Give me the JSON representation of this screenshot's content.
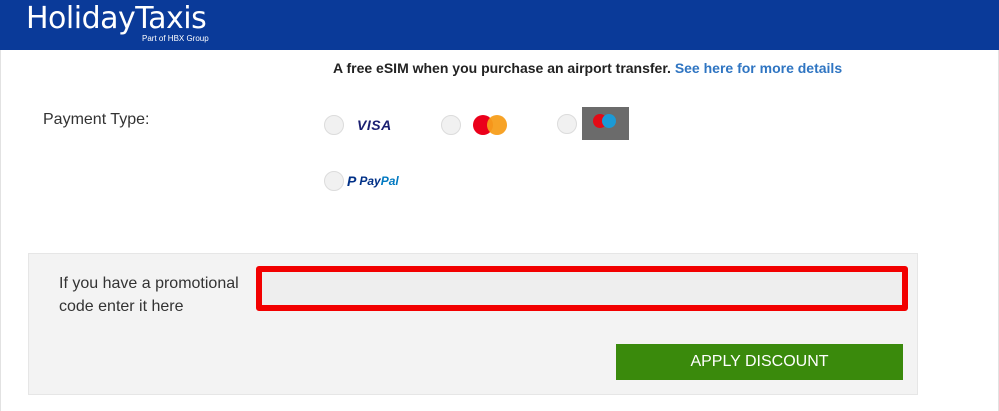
{
  "header": {
    "logo_main": "HolidayTaxis",
    "logo_sub": "Part of HBX Group",
    "background_color": "#0a3a99"
  },
  "promo_banner": {
    "text": "A free eSIM when you purchase an airport transfer.",
    "link_text": "See here for more details",
    "link_color": "#2f75c2"
  },
  "payment": {
    "label": "Payment Type:",
    "options": [
      {
        "name": "visa",
        "label": "VISA",
        "icon": "visa-logo",
        "selected": false
      },
      {
        "name": "mastercard",
        "icon": "mastercard-logo",
        "selected": false
      },
      {
        "name": "maestro",
        "icon": "maestro-logo",
        "selected": false
      },
      {
        "name": "paypal",
        "label_pay": "Pay",
        "label_pal": "Pal",
        "icon": "paypal-logo",
        "selected": false
      }
    ]
  },
  "promo_code": {
    "label": "If you have a promotional code enter it here",
    "value": "",
    "placeholder": "",
    "highlight_color": "#f20000",
    "button_label": "APPLY DISCOUNT",
    "button_color": "#3a8a0c"
  }
}
